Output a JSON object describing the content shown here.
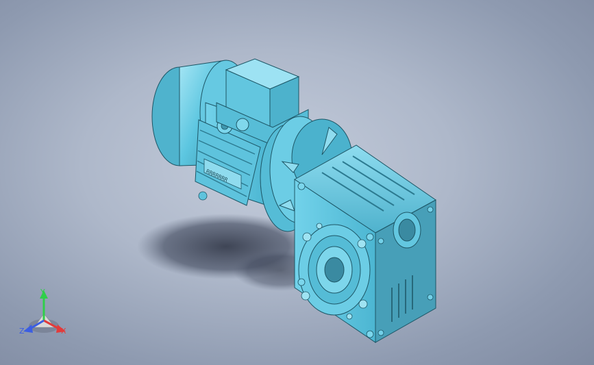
{
  "viewport": {
    "background_top": "#c4ccdb",
    "background_edge": "#7f8aa1",
    "model_color": "#5cc6e0",
    "model_shadow": "#3b7f95",
    "model_highlight": "#9fe3f2"
  },
  "model": {
    "nameplate_text": "RRRRRRR"
  },
  "triad": {
    "x_label": "X",
    "y_label": "Y",
    "z_label": "Z",
    "x_color": "#e23b3b",
    "y_color": "#2fcf4a",
    "z_color": "#3b5ee2"
  }
}
